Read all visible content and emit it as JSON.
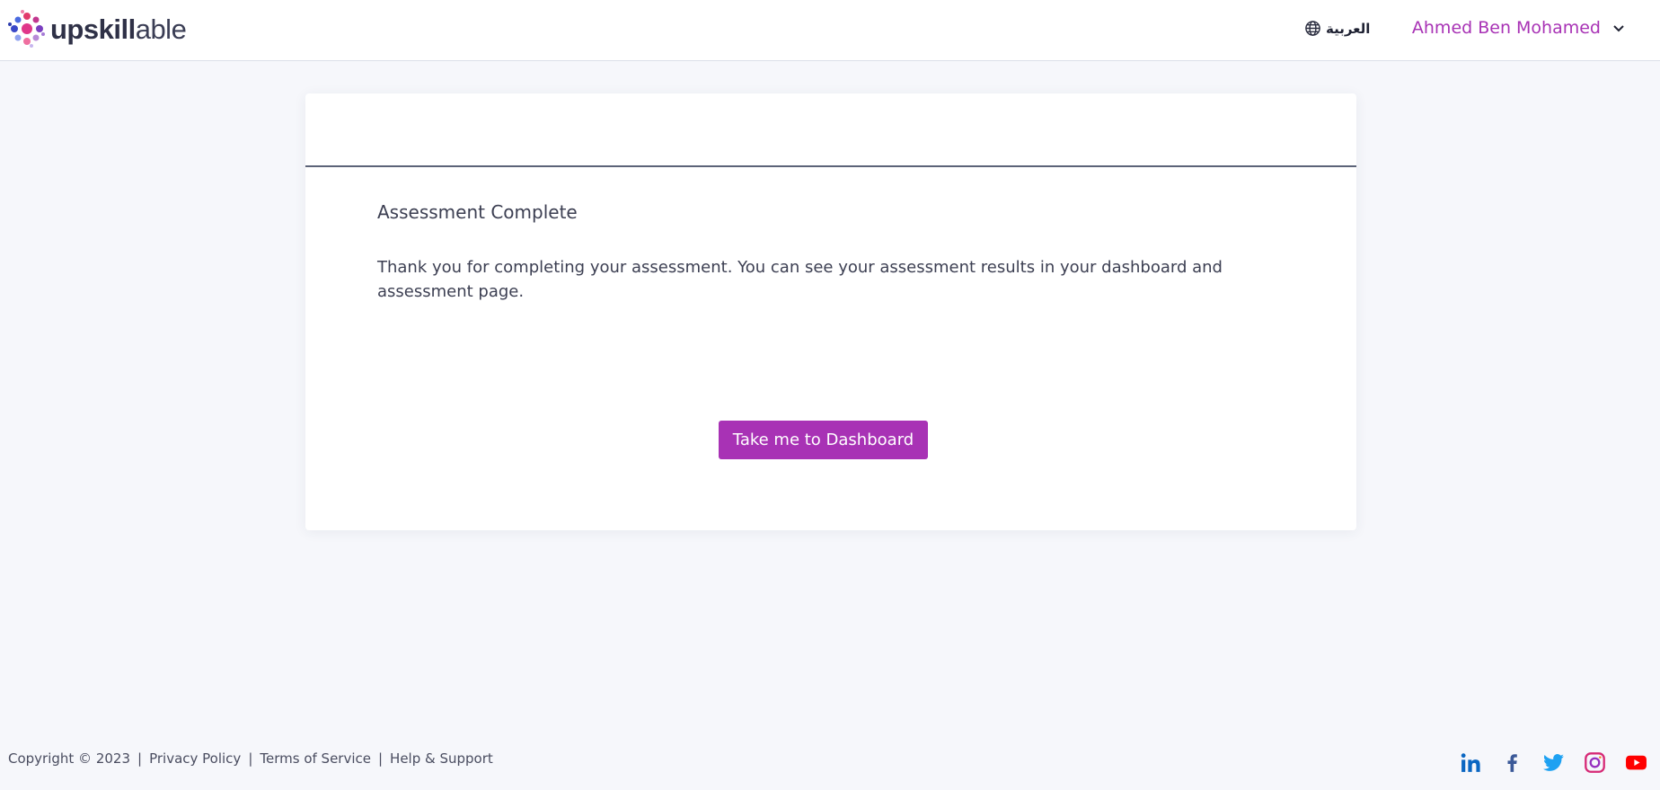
{
  "header": {
    "logo": {
      "strong": "upskill",
      "light": "able"
    },
    "language_label": "العربية",
    "user_name": "Ahmed Ben Mohamed"
  },
  "card": {
    "title": "Assessment Complete",
    "message": "Thank you for completing your assessment. You can see your assessment results in your dashboard and assessment page.",
    "button_label": "Take me to Dashboard"
  },
  "footer": {
    "copyright": "Copyright © 2023",
    "links": [
      "Privacy Policy",
      "Terms of Service",
      "Help & Support"
    ],
    "social": [
      "linkedin-icon",
      "facebook-icon",
      "twitter-icon",
      "instagram-icon",
      "youtube-icon"
    ]
  },
  "colors": {
    "accent": "#a832b5",
    "background": "#f6f7fb",
    "text": "#3c3f52",
    "linkedin": "#0a66c2",
    "facebook": "#3b5998",
    "twitter": "#1da1f2",
    "youtube": "#ff0000"
  }
}
